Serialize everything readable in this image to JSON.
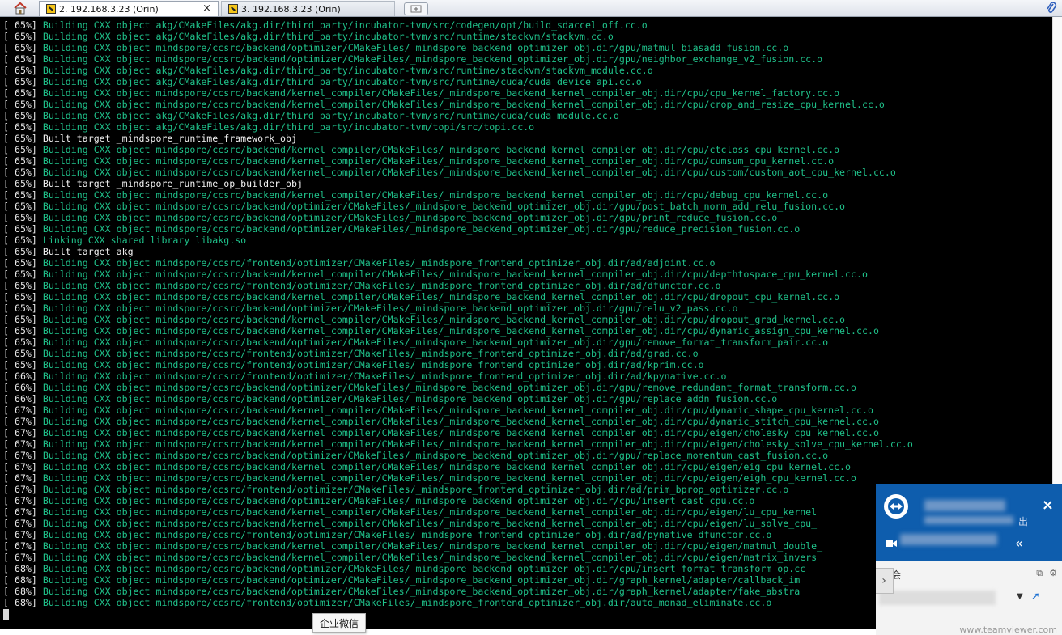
{
  "tabs": {
    "home_icon": "home-icon",
    "active": {
      "label": "2. 192.168.3.23 (Orin)",
      "close": "×"
    },
    "inactive": {
      "label": "3. 192.168.3.23 (Orin)"
    },
    "new_tab_icon": "new-tab-icon",
    "attach_icon": "paperclip-icon"
  },
  "terminal": {
    "colors": {
      "background": "#000000",
      "green": "#1fc18a",
      "white": "#f0f0f0"
    },
    "lines": [
      {
        "pct": "[ 65%]",
        "text": "Building CXX object akg/CMakeFiles/akg.dir/third_party/incubator-tvm/src/codegen/opt/build_sdaccel_off.cc.o",
        "style": "g"
      },
      {
        "pct": "[ 65%]",
        "text": "Building CXX object akg/CMakeFiles/akg.dir/third_party/incubator-tvm/src/runtime/stackvm/stackvm.cc.o",
        "style": "g"
      },
      {
        "pct": "[ 65%]",
        "text": "Building CXX object mindspore/ccsrc/backend/optimizer/CMakeFiles/_mindspore_backend_optimizer_obj.dir/gpu/matmul_biasadd_fusion.cc.o",
        "style": "g"
      },
      {
        "pct": "[ 65%]",
        "text": "Building CXX object mindspore/ccsrc/backend/optimizer/CMakeFiles/_mindspore_backend_optimizer_obj.dir/gpu/neighbor_exchange_v2_fusion.cc.o",
        "style": "g"
      },
      {
        "pct": "[ 65%]",
        "text": "Building CXX object akg/CMakeFiles/akg.dir/third_party/incubator-tvm/src/runtime/stackvm/stackvm_module.cc.o",
        "style": "g"
      },
      {
        "pct": "[ 65%]",
        "text": "Building CXX object akg/CMakeFiles/akg.dir/third_party/incubator-tvm/src/runtime/cuda/cuda_device_api.cc.o",
        "style": "g"
      },
      {
        "pct": "[ 65%]",
        "text": "Building CXX object mindspore/ccsrc/backend/kernel_compiler/CMakeFiles/_mindspore_backend_kernel_compiler_obj.dir/cpu/cpu_kernel_factory.cc.o",
        "style": "g"
      },
      {
        "pct": "[ 65%]",
        "text": "Building CXX object mindspore/ccsrc/backend/kernel_compiler/CMakeFiles/_mindspore_backend_kernel_compiler_obj.dir/cpu/crop_and_resize_cpu_kernel.cc.o",
        "style": "g"
      },
      {
        "pct": "[ 65%]",
        "text": "Building CXX object akg/CMakeFiles/akg.dir/third_party/incubator-tvm/src/runtime/cuda/cuda_module.cc.o",
        "style": "g"
      },
      {
        "pct": "[ 65%]",
        "text": "Building CXX object akg/CMakeFiles/akg.dir/third_party/incubator-tvm/topi/src/topi.cc.o",
        "style": "g"
      },
      {
        "pct": "[ 65%]",
        "text": "Built target _mindspore_runtime_framework_obj",
        "style": "w"
      },
      {
        "pct": "[ 65%]",
        "text": "Building CXX object mindspore/ccsrc/backend/kernel_compiler/CMakeFiles/_mindspore_backend_kernel_compiler_obj.dir/cpu/ctcloss_cpu_kernel.cc.o",
        "style": "g"
      },
      {
        "pct": "[ 65%]",
        "text": "Building CXX object mindspore/ccsrc/backend/kernel_compiler/CMakeFiles/_mindspore_backend_kernel_compiler_obj.dir/cpu/cumsum_cpu_kernel.cc.o",
        "style": "g"
      },
      {
        "pct": "[ 65%]",
        "text": "Building CXX object mindspore/ccsrc/backend/kernel_compiler/CMakeFiles/_mindspore_backend_kernel_compiler_obj.dir/cpu/custom/custom_aot_cpu_kernel.cc.o",
        "style": "g"
      },
      {
        "pct": "[ 65%]",
        "text": "Built target _mindspore_runtime_op_builder_obj",
        "style": "w"
      },
      {
        "pct": "[ 65%]",
        "text": "Building CXX object mindspore/ccsrc/backend/kernel_compiler/CMakeFiles/_mindspore_backend_kernel_compiler_obj.dir/cpu/debug_cpu_kernel.cc.o",
        "style": "g"
      },
      {
        "pct": "[ 65%]",
        "text": "Building CXX object mindspore/ccsrc/backend/optimizer/CMakeFiles/_mindspore_backend_optimizer_obj.dir/gpu/post_batch_norm_add_relu_fusion.cc.o",
        "style": "g"
      },
      {
        "pct": "[ 65%]",
        "text": "Building CXX object mindspore/ccsrc/backend/optimizer/CMakeFiles/_mindspore_backend_optimizer_obj.dir/gpu/print_reduce_fusion.cc.o",
        "style": "g"
      },
      {
        "pct": "[ 65%]",
        "text": "Building CXX object mindspore/ccsrc/backend/optimizer/CMakeFiles/_mindspore_backend_optimizer_obj.dir/gpu/reduce_precision_fusion.cc.o",
        "style": "g"
      },
      {
        "pct": "[ 65%]",
        "text": "Linking CXX shared library libakg.so",
        "style": "g"
      },
      {
        "pct": "[ 65%]",
        "text": "Built target akg",
        "style": "w"
      },
      {
        "pct": "[ 65%]",
        "text": "Building CXX object mindspore/ccsrc/frontend/optimizer/CMakeFiles/_mindspore_frontend_optimizer_obj.dir/ad/adjoint.cc.o",
        "style": "g"
      },
      {
        "pct": "[ 65%]",
        "text": "Building CXX object mindspore/ccsrc/backend/kernel_compiler/CMakeFiles/_mindspore_backend_kernel_compiler_obj.dir/cpu/depthtospace_cpu_kernel.cc.o",
        "style": "g"
      },
      {
        "pct": "[ 65%]",
        "text": "Building CXX object mindspore/ccsrc/frontend/optimizer/CMakeFiles/_mindspore_frontend_optimizer_obj.dir/ad/dfunctor.cc.o",
        "style": "g"
      },
      {
        "pct": "[ 65%]",
        "text": "Building CXX object mindspore/ccsrc/backend/kernel_compiler/CMakeFiles/_mindspore_backend_kernel_compiler_obj.dir/cpu/dropout_cpu_kernel.cc.o",
        "style": "g"
      },
      {
        "pct": "[ 65%]",
        "text": "Building CXX object mindspore/ccsrc/backend/optimizer/CMakeFiles/_mindspore_backend_optimizer_obj.dir/gpu/relu_v2_pass.cc.o",
        "style": "g"
      },
      {
        "pct": "[ 65%]",
        "text": "Building CXX object mindspore/ccsrc/backend/kernel_compiler/CMakeFiles/_mindspore_backend_kernel_compiler_obj.dir/cpu/dropout_grad_kernel.cc.o",
        "style": "g"
      },
      {
        "pct": "[ 65%]",
        "text": "Building CXX object mindspore/ccsrc/backend/kernel_compiler/CMakeFiles/_mindspore_backend_kernel_compiler_obj.dir/cpu/dynamic_assign_cpu_kernel.cc.o",
        "style": "g"
      },
      {
        "pct": "[ 65%]",
        "text": "Building CXX object mindspore/ccsrc/backend/optimizer/CMakeFiles/_mindspore_backend_optimizer_obj.dir/gpu/remove_format_transform_pair.cc.o",
        "style": "g"
      },
      {
        "pct": "[ 65%]",
        "text": "Building CXX object mindspore/ccsrc/frontend/optimizer/CMakeFiles/_mindspore_frontend_optimizer_obj.dir/ad/grad.cc.o",
        "style": "g"
      },
      {
        "pct": "[ 65%]",
        "text": "Building CXX object mindspore/ccsrc/frontend/optimizer/CMakeFiles/_mindspore_frontend_optimizer_obj.dir/ad/kprim.cc.o",
        "style": "g"
      },
      {
        "pct": "[ 66%]",
        "text": "Building CXX object mindspore/ccsrc/frontend/optimizer/CMakeFiles/_mindspore_frontend_optimizer_obj.dir/ad/kpynative.cc.o",
        "style": "g"
      },
      {
        "pct": "[ 66%]",
        "text": "Building CXX object mindspore/ccsrc/backend/optimizer/CMakeFiles/_mindspore_backend_optimizer_obj.dir/gpu/remove_redundant_format_transform.cc.o",
        "style": "g"
      },
      {
        "pct": "[ 66%]",
        "text": "Building CXX object mindspore/ccsrc/backend/optimizer/CMakeFiles/_mindspore_backend_optimizer_obj.dir/gpu/replace_addn_fusion.cc.o",
        "style": "g"
      },
      {
        "pct": "[ 67%]",
        "text": "Building CXX object mindspore/ccsrc/backend/kernel_compiler/CMakeFiles/_mindspore_backend_kernel_compiler_obj.dir/cpu/dynamic_shape_cpu_kernel.cc.o",
        "style": "g"
      },
      {
        "pct": "[ 67%]",
        "text": "Building CXX object mindspore/ccsrc/backend/kernel_compiler/CMakeFiles/_mindspore_backend_kernel_compiler_obj.dir/cpu/dynamic_stitch_cpu_kernel.cc.o",
        "style": "g"
      },
      {
        "pct": "[ 67%]",
        "text": "Building CXX object mindspore/ccsrc/backend/kernel_compiler/CMakeFiles/_mindspore_backend_kernel_compiler_obj.dir/cpu/eigen/cholesky_cpu_kernel.cc.o",
        "style": "g"
      },
      {
        "pct": "[ 67%]",
        "text": "Building CXX object mindspore/ccsrc/backend/kernel_compiler/CMakeFiles/_mindspore_backend_kernel_compiler_obj.dir/cpu/eigen/cholesky_solve_cpu_kernel.cc.o",
        "style": "g"
      },
      {
        "pct": "[ 67%]",
        "text": "Building CXX object mindspore/ccsrc/backend/optimizer/CMakeFiles/_mindspore_backend_optimizer_obj.dir/gpu/replace_momentum_cast_fusion.cc.o",
        "style": "g"
      },
      {
        "pct": "[ 67%]",
        "text": "Building CXX object mindspore/ccsrc/backend/kernel_compiler/CMakeFiles/_mindspore_backend_kernel_compiler_obj.dir/cpu/eigen/eig_cpu_kernel.cc.o",
        "style": "g"
      },
      {
        "pct": "[ 67%]",
        "text": "Building CXX object mindspore/ccsrc/backend/kernel_compiler/CMakeFiles/_mindspore_backend_kernel_compiler_obj.dir/cpu/eigen/eigh_cpu_kernel.cc.o",
        "style": "g"
      },
      {
        "pct": "[ 67%]",
        "text": "Building CXX object mindspore/ccsrc/frontend/optimizer/CMakeFiles/_mindspore_frontend_optimizer_obj.dir/ad/prim_bprop_optimizer.cc.o",
        "style": "g"
      },
      {
        "pct": "[ 67%]",
        "text": "Building CXX object mindspore/ccsrc/backend/optimizer/CMakeFiles/_mindspore_backend_optimizer_obj.dir/cpu/insert_cast_cpu.cc.o",
        "style": "g"
      },
      {
        "pct": "[ 67%]",
        "text": "Building CXX object mindspore/ccsrc/backend/kernel_compiler/CMakeFiles/_mindspore_backend_kernel_compiler_obj.dir/cpu/eigen/lu_cpu_kernel",
        "style": "g"
      },
      {
        "pct": "[ 67%]",
        "text": "Building CXX object mindspore/ccsrc/backend/kernel_compiler/CMakeFiles/_mindspore_backend_kernel_compiler_obj.dir/cpu/eigen/lu_solve_cpu_",
        "style": "g"
      },
      {
        "pct": "[ 67%]",
        "text": "Building CXX object mindspore/ccsrc/frontend/optimizer/CMakeFiles/_mindspore_frontend_optimizer_obj.dir/ad/pynative_dfunctor.cc.o",
        "style": "g"
      },
      {
        "pct": "[ 67%]",
        "text": "Building CXX object mindspore/ccsrc/backend/kernel_compiler/CMakeFiles/_mindspore_backend_kernel_compiler_obj.dir/cpu/eigen/matmul_double_",
        "style": "g"
      },
      {
        "pct": "[ 67%]",
        "text": "Building CXX object mindspore/ccsrc/backend/kernel_compiler/CMakeFiles/_mindspore_backend_kernel_compiler_obj.dir/cpu/eigen/matrix_invers",
        "style": "g"
      },
      {
        "pct": "[ 68%]",
        "text": "Building CXX object mindspore/ccsrc/backend/optimizer/CMakeFiles/_mindspore_backend_optimizer_obj.dir/cpu/insert_format_transform_op.cc",
        "style": "g"
      },
      {
        "pct": "[ 68%]",
        "text": "Building CXX object mindspore/ccsrc/backend/optimizer/CMakeFiles/_mindspore_backend_optimizer_obj.dir/graph_kernel/adapter/callback_im",
        "style": "g"
      },
      {
        "pct": "[ 68%]",
        "text": "Building CXX object mindspore/ccsrc/backend/optimizer/CMakeFiles/_mindspore_backend_optimizer_obj.dir/graph_kernel/adapter/fake_abstra",
        "style": "g"
      },
      {
        "pct": "[ 68%]",
        "text": "Building CXX object mindspore/ccsrc/frontend/optimizer/CMakeFiles/_mindspore_frontend_optimizer_obj.dir/auto_monad_eliminate.cc.o",
        "style": "g"
      }
    ]
  },
  "tooltip": {
    "label": "企业微信"
  },
  "teamviewer": {
    "logo_icon": "teamviewer-logo-icon",
    "close": "×",
    "side_text": "出",
    "chevron": "«",
    "row_label": "会",
    "row_arrow": "▼",
    "expand_arrow": "▼",
    "side_tab": "›",
    "footer": "www.teamviewer.com"
  }
}
